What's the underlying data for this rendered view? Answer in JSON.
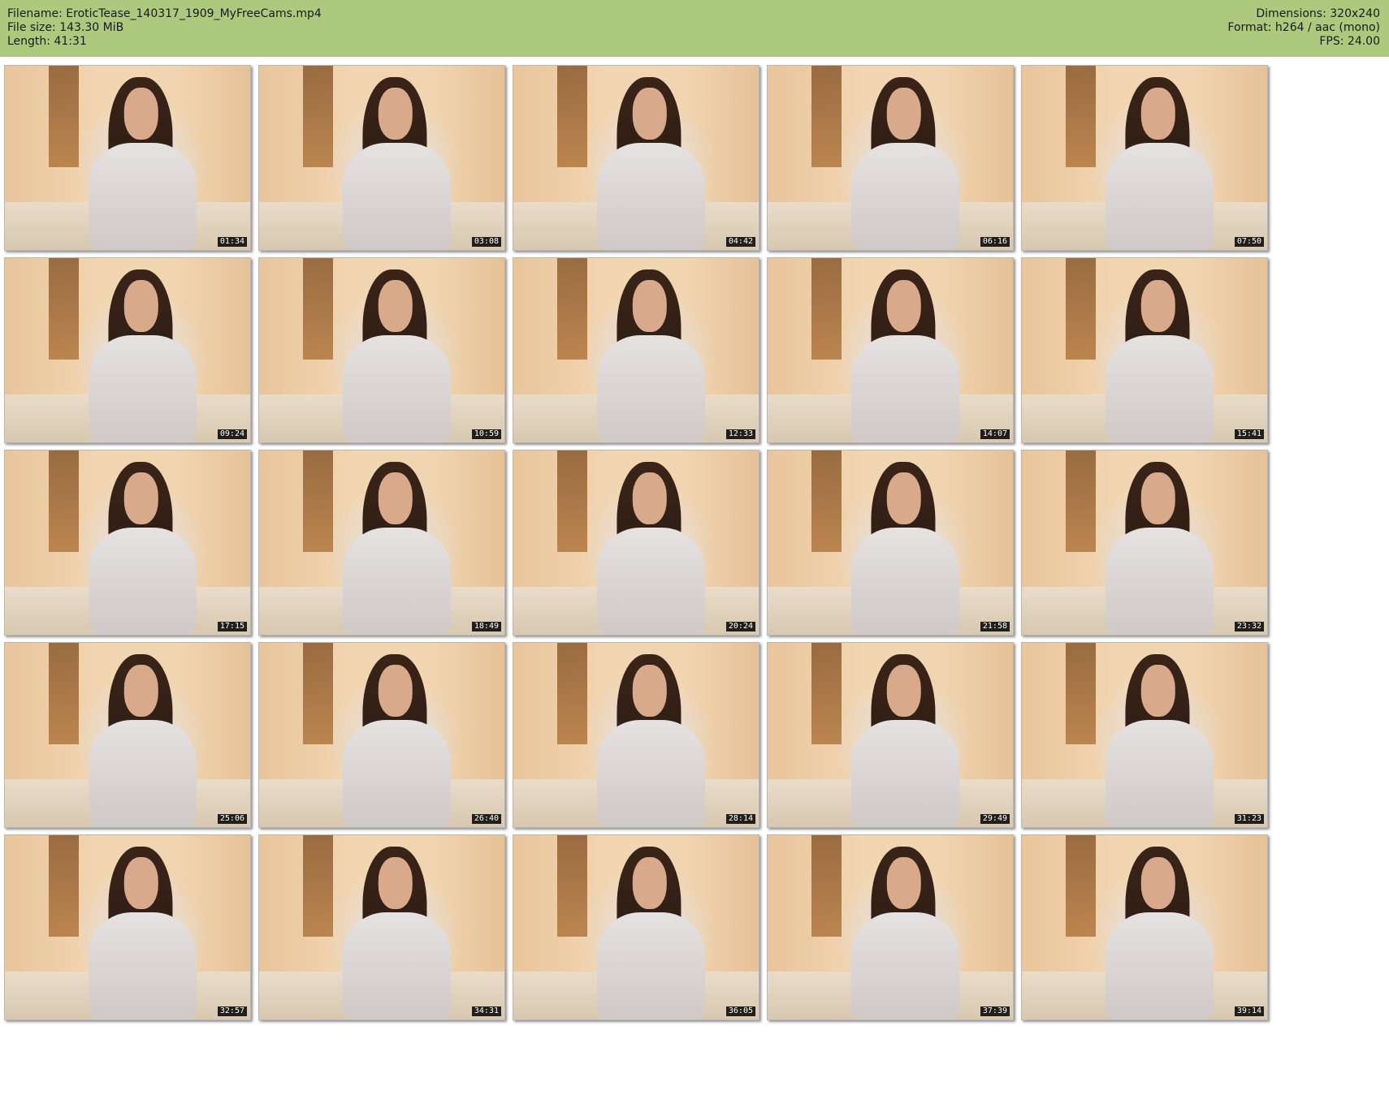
{
  "header": {
    "filename": "Filename: EroticTease_140317_1909_MyFreeCams.mp4",
    "file_size": "File size: 143.30 MiB",
    "length": "Length: 41:31",
    "dimensions": "Dimensions: 320x240",
    "format": "Format: h264 / aac (mono)",
    "fps": "FPS: 24.00"
  },
  "colors": {
    "header_bg": "#acc97e",
    "timecode_bg": "#000000",
    "timecode_text": "#ffffff"
  },
  "thumbnails": [
    {
      "time": "01:34"
    },
    {
      "time": "03:08"
    },
    {
      "time": "04:42"
    },
    {
      "time": "06:16"
    },
    {
      "time": "07:50"
    },
    {
      "time": "09:24"
    },
    {
      "time": "10:59"
    },
    {
      "time": "12:33"
    },
    {
      "time": "14:07"
    },
    {
      "time": "15:41"
    },
    {
      "time": "17:15"
    },
    {
      "time": "18:49"
    },
    {
      "time": "20:24"
    },
    {
      "time": "21:58"
    },
    {
      "time": "23:32"
    },
    {
      "time": "25:06"
    },
    {
      "time": "26:40"
    },
    {
      "time": "28:14"
    },
    {
      "time": "29:49"
    },
    {
      "time": "31:23"
    },
    {
      "time": "32:57"
    },
    {
      "time": "34:31"
    },
    {
      "time": "36:05"
    },
    {
      "time": "37:39"
    },
    {
      "time": "39:14"
    }
  ]
}
